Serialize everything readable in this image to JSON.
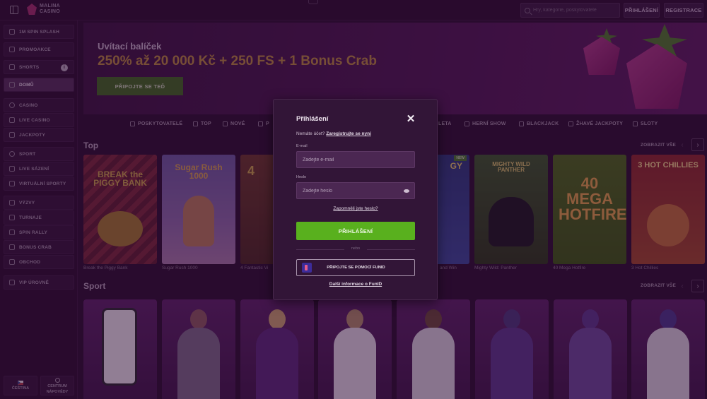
{
  "brand": {
    "line1": "MALINA",
    "line2": "CASINO"
  },
  "topbar": {
    "search_placeholder": "Hry, kategorie, poskytovatelé",
    "login_label": "PŘIHLÁŠENÍ",
    "register_label": "REGISTRACE"
  },
  "sidebar": {
    "top_items": [
      {
        "label": "1M SPIN SPLASH",
        "icon": "rocket-icon"
      },
      {
        "label": "PROMOAKCE",
        "icon": "gift-icon"
      },
      {
        "label": "SHORTS",
        "icon": "play-icon"
      },
      {
        "label": "DOMŮ",
        "icon": "home-icon"
      }
    ],
    "casino_items": [
      {
        "label": "CASINO",
        "icon": "casino-icon"
      },
      {
        "label": "LIVE CASINO",
        "icon": "live-icon"
      },
      {
        "label": "JACKPOTY",
        "icon": "jackpot-icon"
      }
    ],
    "sport_items": [
      {
        "label": "SPORT",
        "icon": "ball-icon"
      },
      {
        "label": "LIVE SÁZENÍ",
        "icon": "live-bet-icon"
      },
      {
        "label": "VIRTUÁLNÍ SPORTY",
        "icon": "virtual-icon"
      }
    ],
    "extra_items": [
      {
        "label": "VÝZVY",
        "icon": "challenge-icon"
      },
      {
        "label": "TURNAJE",
        "icon": "trophy-icon"
      },
      {
        "label": "SPIN RALLY",
        "icon": "rally-icon"
      },
      {
        "label": "BONUS CRAB",
        "icon": "crab-icon"
      },
      {
        "label": "OBCHOD",
        "icon": "shop-icon"
      }
    ],
    "vip_item": {
      "label": "VIP ÚROVNĚ",
      "icon": "crown-icon"
    },
    "shorts_info": "i",
    "language_label": "ČEŠTINA",
    "help_label_1": "CENTRUM",
    "help_label_2": "NÁPOVĚDY"
  },
  "hero": {
    "subtitle": "Uvítací balíček",
    "title": "250% až 20 000 Kč + 250 FS + 1 Bonus Crab",
    "cta_label": "PŘIPOJTE SE TEĎ"
  },
  "categories": [
    {
      "label": "POSKYTOVATELÉ"
    },
    {
      "label": "TOP"
    },
    {
      "label": "NOVÉ"
    },
    {
      "label": "P"
    },
    {
      "label": "LETA"
    },
    {
      "label": "HERNÍ SHOW"
    },
    {
      "label": "BLACKJACK"
    },
    {
      "label": "ŽHAVÉ JACKPOTY"
    },
    {
      "label": "SLOTY"
    }
  ],
  "top_section": {
    "title": "Top",
    "show_all": "ZOBRAZIT VŠE",
    "games": [
      {
        "name": "Break the Piggy Bank",
        "art": "BREAK the PIGGY BANK"
      },
      {
        "name": "Sugar Rush 1000",
        "art": "Sugar Rush 1000"
      },
      {
        "name": "4 Fantastic Vi",
        "art": "4"
      },
      {
        "name": "and Win",
        "art": "GY",
        "badge": "NEW"
      },
      {
        "name": "Mighty Wild: Panther",
        "art": "MIGHTY WILD PANTHER"
      },
      {
        "name": "40 Mega Hotfire",
        "art": "40 MEGA HOTFIRE"
      },
      {
        "name": "3 Hot Chillies",
        "art": "3 HOT CHILLIES"
      }
    ]
  },
  "sport_section": {
    "title": "Sport",
    "show_all": "ZOBRAZIT VŠE"
  },
  "modal": {
    "title": "Přihlášení",
    "close": "✕",
    "no_account_text": "Nemáte účet?",
    "register_link": "Zaregistrujte se nyní",
    "email_label": "E-mail",
    "email_placeholder": "Zadejte e-mail",
    "password_label": "Heslo",
    "password_placeholder": "Zadejte heslo",
    "forgot_label": "Zapomněli jste heslo?",
    "submit_label": "PŘIHLÁŠENÍ",
    "or_label": "nebo",
    "funid_label": "PŘIPOJTE SE POMOCÍ FUNID",
    "more_info_label": "Další informace o FunID"
  },
  "colors": {
    "background": "#2b1130",
    "accent_green": "#59b01e",
    "hero_gold": "#b88b3e",
    "modal_bg": "#321537"
  }
}
